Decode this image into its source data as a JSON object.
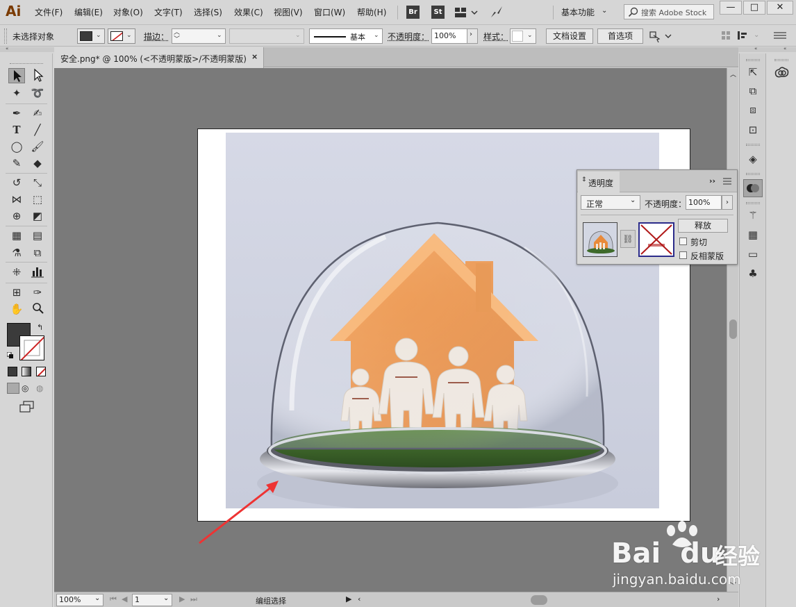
{
  "app": {
    "logo": "Ai"
  },
  "menu": [
    "文件(F)",
    "编辑(E)",
    "对象(O)",
    "文字(T)",
    "选择(S)",
    "效果(C)",
    "视图(V)",
    "窗口(W)",
    "帮助(H)"
  ],
  "bridge_badges": [
    "Br",
    "St"
  ],
  "workspace": {
    "label": "基本功能"
  },
  "search": {
    "placeholder": "搜索 Adobe Stock"
  },
  "window_controls": [
    "—",
    "□",
    "✕"
  ],
  "control_bar": {
    "selection_status": "未选择对象",
    "stroke_label": "描边：",
    "stroke_style_label": "基本",
    "opacity_label": "不透明度：",
    "opacity_value": "100%",
    "style_label": "样式：",
    "doc_setup_button": "文档设置",
    "preferences_button": "首选项"
  },
  "document": {
    "tab_label": "安全.png* @ 100% (<不透明蒙版>/不透明蒙版)",
    "tab_close": "×"
  },
  "status_bar": {
    "zoom": "100%",
    "page": "1",
    "mode": "编组选择"
  },
  "transparency_panel": {
    "title": "透明度",
    "blend_mode": "正常",
    "opacity_label": "不透明度：",
    "opacity_value": "100%",
    "release_button": "释放",
    "clip_label": "剪切",
    "invert_label": "反相蒙版",
    "clip_checked": false,
    "invert_checked": false
  },
  "watermark": {
    "brand": "Bai",
    "brand_tail": "du",
    "suffix": "经验",
    "url": "jingyan.baidu.com"
  },
  "colors": {
    "fill": "#3b3b3b",
    "accent_red": "#cc2222",
    "house": "#e8873a",
    "grass": "#3d6a2a",
    "arrow": "#ee3333"
  }
}
